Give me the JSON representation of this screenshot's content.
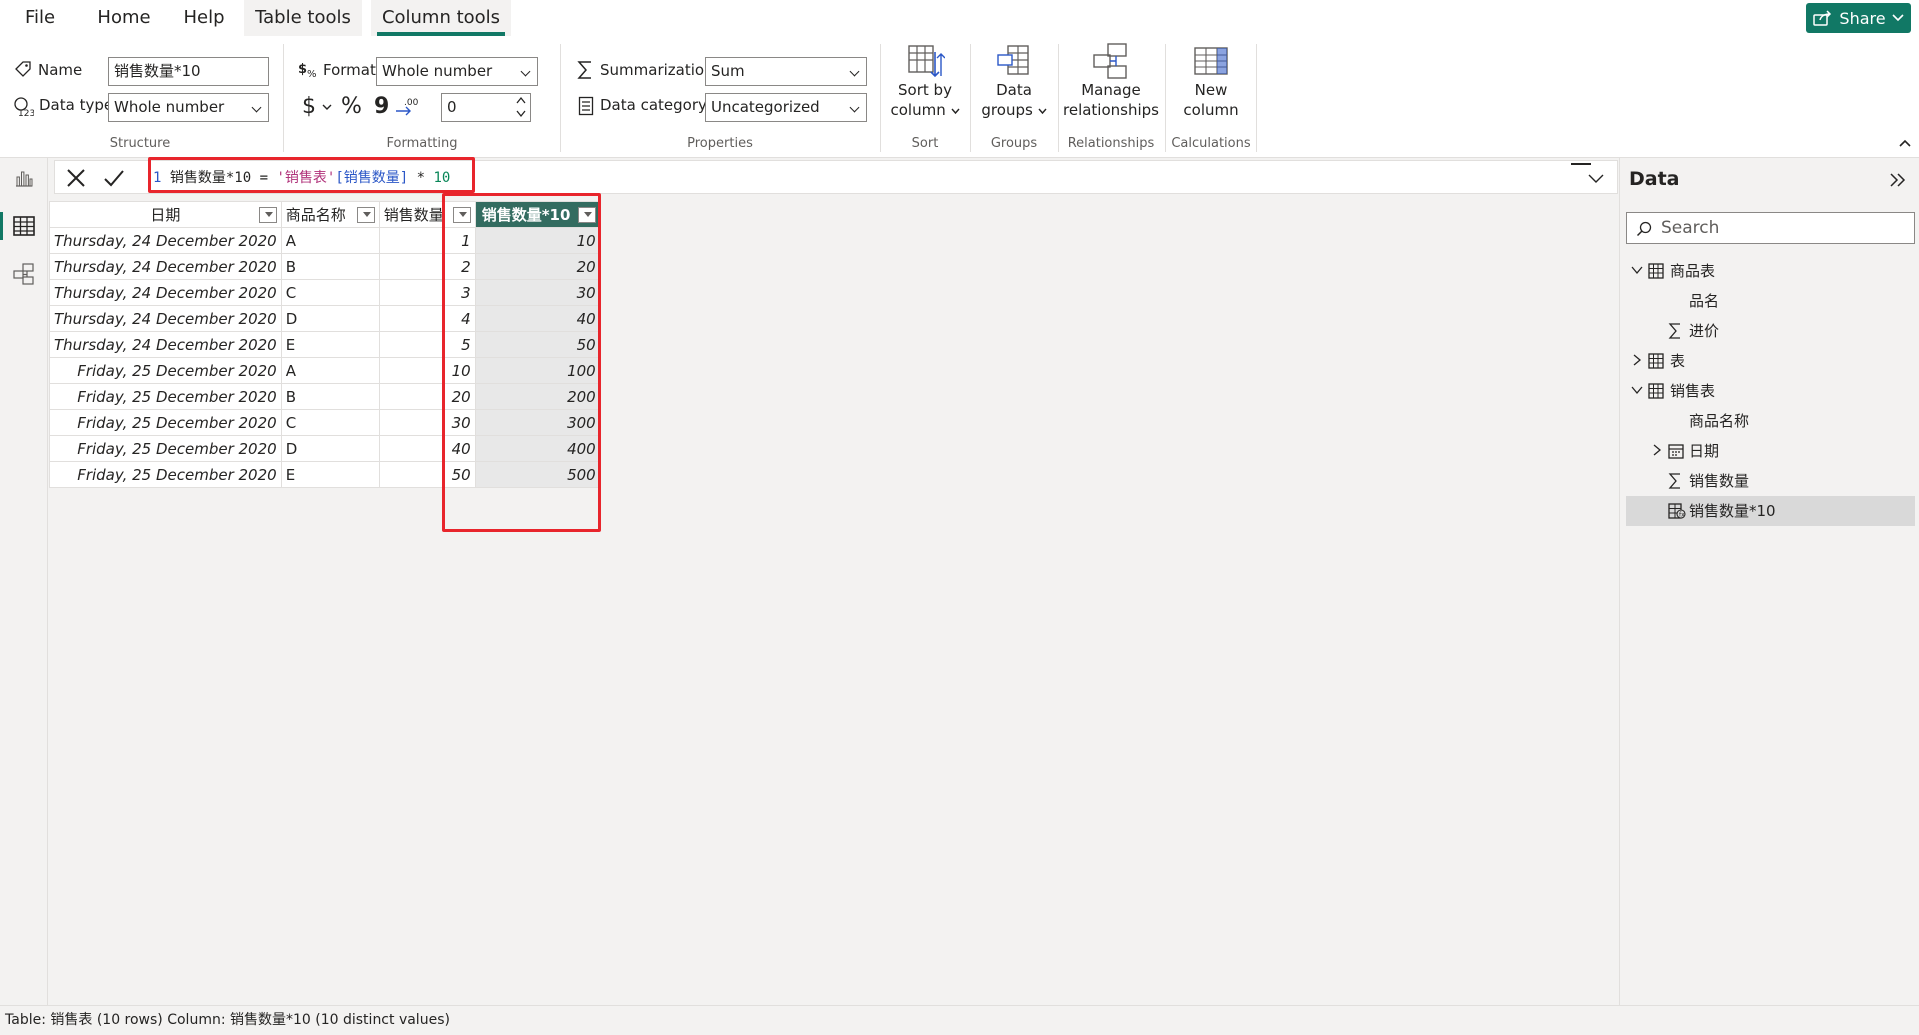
{
  "menu": {
    "tabs": [
      {
        "label": "File"
      },
      {
        "label": "Home"
      },
      {
        "label": "Help"
      },
      {
        "label": "Table tools"
      },
      {
        "label": "Column tools"
      }
    ],
    "share_label": "Share"
  },
  "ribbon": {
    "structure": {
      "group_label": "Structure",
      "name_label": "Name",
      "name_value": "销售数量*10",
      "datatype_label": "Data type",
      "datatype_value": "Whole number"
    },
    "formatting": {
      "group_label": "Formatting",
      "format_label": "Format",
      "format_value": "Whole number",
      "currency_symbol": "$",
      "percent_symbol": "%",
      "comma_symbol": "9",
      "decimal_places": "0"
    },
    "properties": {
      "group_label": "Properties",
      "summarization_label": "Summarization",
      "summarization_value": "Sum",
      "category_label": "Data category",
      "category_value": "Uncategorized"
    },
    "sort": {
      "group_label": "Sort",
      "button_line1": "Sort by",
      "button_line2": "column"
    },
    "groups": {
      "group_label": "Groups",
      "button_line1": "Data",
      "button_line2": "groups"
    },
    "relationships": {
      "group_label": "Relationships",
      "button_line1": "Manage",
      "button_line2": "relationships"
    },
    "calculations": {
      "group_label": "Calculations",
      "button_line1": "New",
      "button_line2": "column"
    }
  },
  "formula": {
    "line_number": "1",
    "name_part": "销售数量*10 = ",
    "table_part": "'销售表'",
    "column_part": "[销售数量]",
    "operator_part": " * ",
    "number_part": "10"
  },
  "table": {
    "columns": [
      "日期",
      "商品名称",
      "销售数量",
      "销售数量*10"
    ],
    "rows": [
      [
        "Thursday, 24 December 2020",
        "A",
        "1",
        "10"
      ],
      [
        "Thursday, 24 December 2020",
        "B",
        "2",
        "20"
      ],
      [
        "Thursday, 24 December 2020",
        "C",
        "3",
        "30"
      ],
      [
        "Thursday, 24 December 2020",
        "D",
        "4",
        "40"
      ],
      [
        "Thursday, 24 December 2020",
        "E",
        "5",
        "50"
      ],
      [
        "Friday, 25 December 2020",
        "A",
        "10",
        "100"
      ],
      [
        "Friday, 25 December 2020",
        "B",
        "20",
        "200"
      ],
      [
        "Friday, 25 December 2020",
        "C",
        "30",
        "300"
      ],
      [
        "Friday, 25 December 2020",
        "D",
        "40",
        "400"
      ],
      [
        "Friday, 25 December 2020",
        "E",
        "50",
        "500"
      ]
    ]
  },
  "data_pane": {
    "title": "Data",
    "search_placeholder": "Search",
    "tree": [
      {
        "label": "商品表",
        "level": 0,
        "expander": "expanded",
        "icon": "table-icon"
      },
      {
        "label": "品名",
        "level": 1,
        "expander": "",
        "icon": ""
      },
      {
        "label": "进价",
        "level": 1,
        "expander": "",
        "icon": "sigma-icon"
      },
      {
        "label": "表",
        "level": 0,
        "expander": "collapsed",
        "icon": "table-icon"
      },
      {
        "label": "销售表",
        "level": 0,
        "expander": "expanded",
        "icon": "table-icon"
      },
      {
        "label": "商品名称",
        "level": 1,
        "expander": "",
        "icon": ""
      },
      {
        "label": "日期",
        "level": 1,
        "expander": "collapsed",
        "icon": "calendar-icon"
      },
      {
        "label": "销售数量",
        "level": 1,
        "expander": "",
        "icon": "sigma-icon"
      },
      {
        "label": "销售数量*10",
        "level": 1,
        "expander": "",
        "icon": "calculated-column-icon",
        "selected": true
      }
    ]
  },
  "status": {
    "text": "Table: 销售表 (10 rows) Column: 销售数量*10 (10 distinct values)"
  },
  "colors": {
    "accent": "#117865",
    "header_selected": "#336c60",
    "highlight": "#e8252c"
  }
}
